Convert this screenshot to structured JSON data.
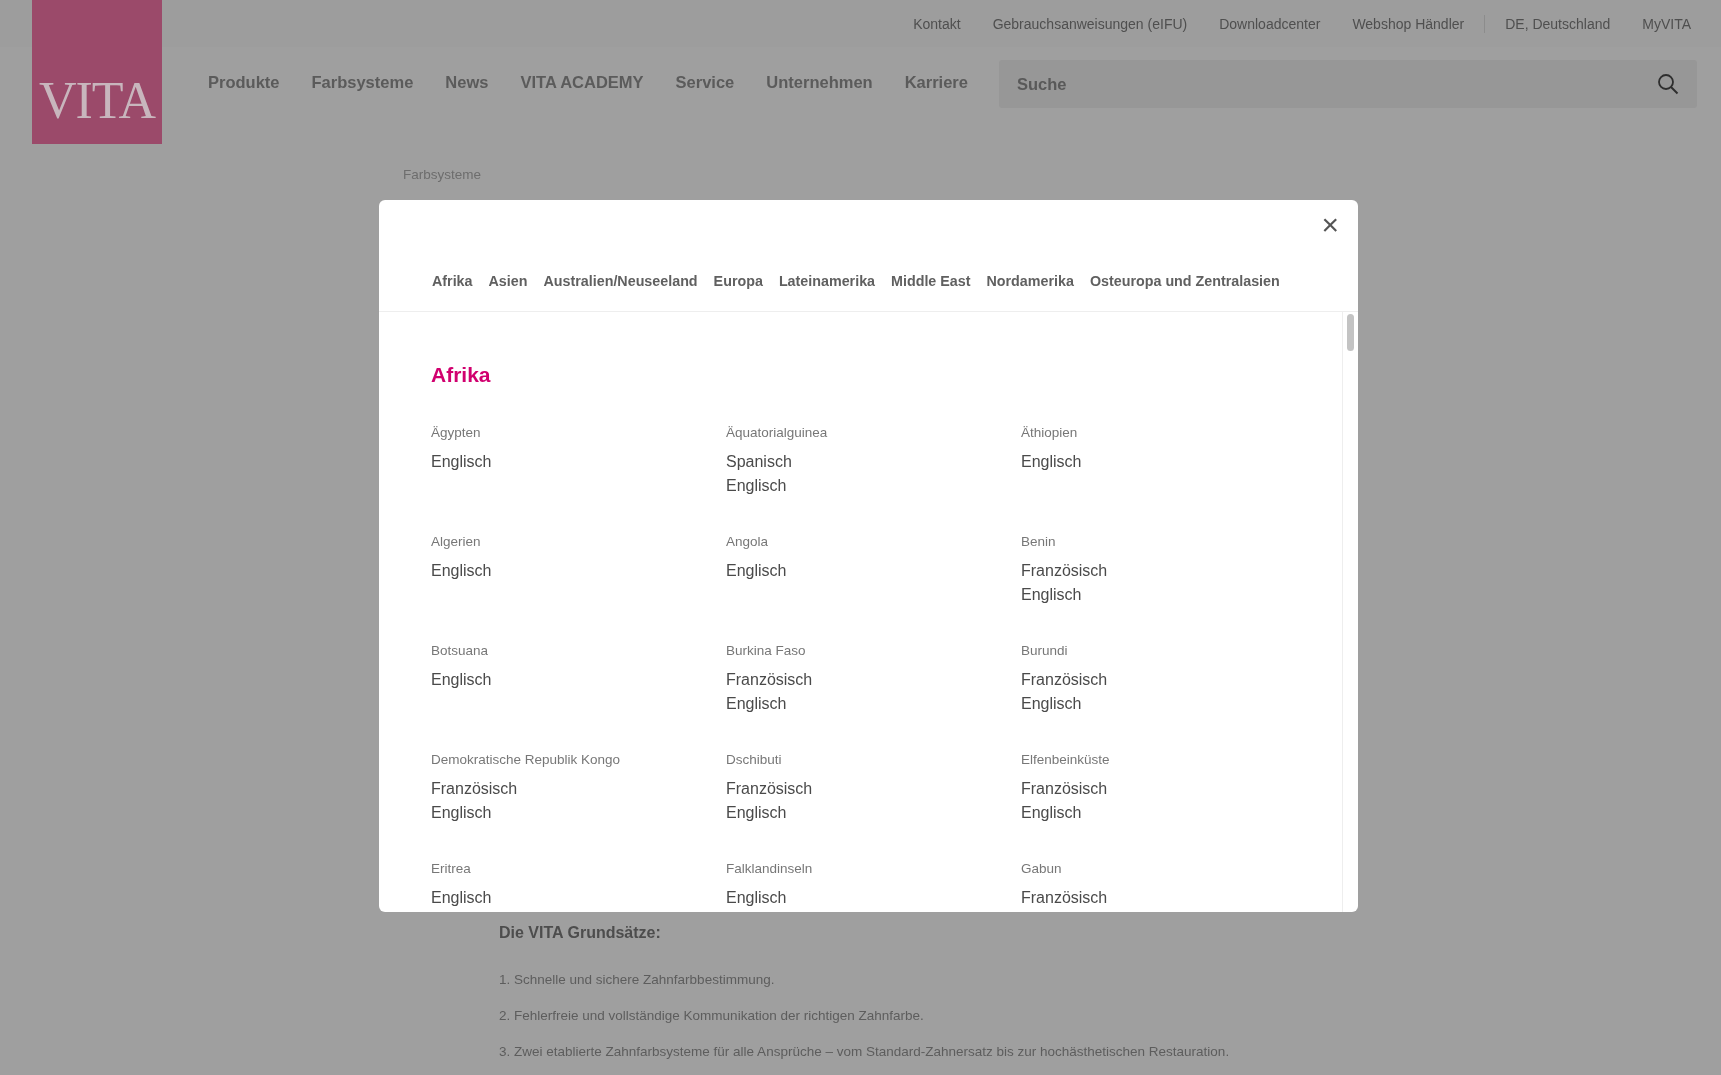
{
  "top_links": [
    "Kontakt",
    "Gebrauchsanweisungen (eIFU)",
    "Downloadcenter",
    "Webshop Händler",
    "DE, Deutschland",
    "MyVITA"
  ],
  "logo": {
    "text": "VITA"
  },
  "nav": [
    "Produkte",
    "Farbsysteme",
    "News",
    "VITA ACADEMY",
    "Service",
    "Unternehmen",
    "Karriere"
  ],
  "search": {
    "placeholder": "Suche"
  },
  "breadcrumb": "Farbsysteme",
  "page_heading": "Die VITA Grundsätze:",
  "page_list": [
    "1. Schnelle und sichere Zahnfarbbestimmung.",
    "2. Fehlerfreie und vollständige Kommunikation der richtigen Zahnfarbe.",
    "3. Zwei etablierte Zahnfarbsysteme für alle Ansprüche – vom Standard-Zahnersatz bis zur hochästhetischen Restauration."
  ],
  "modal": {
    "close": "×",
    "tabs": [
      {
        "label": "Afrika",
        "selected": false
      },
      {
        "label": "Asien",
        "selected": false
      },
      {
        "label": "Australien/Neuseeland",
        "selected": false
      },
      {
        "label": "Europa",
        "selected": false
      },
      {
        "label": "Lateinamerika",
        "selected": false
      },
      {
        "label": "Middle East",
        "selected": false
      },
      {
        "label": "Nordamerika",
        "selected": false
      },
      {
        "label": "Osteuropa und Zentralasien",
        "selected": false
      }
    ],
    "section_title": "Afrika",
    "countries": [
      {
        "name": "Ägypten",
        "languages": [
          "Englisch"
        ]
      },
      {
        "name": "Äquatorialguinea",
        "languages": [
          "Spanisch",
          "Englisch"
        ]
      },
      {
        "name": "Äthiopien",
        "languages": [
          "Englisch"
        ]
      },
      {
        "name": "Algerien",
        "languages": [
          "Englisch"
        ]
      },
      {
        "name": "Angola",
        "languages": [
          "Englisch"
        ]
      },
      {
        "name": "Benin",
        "languages": [
          "Französisch",
          "Englisch"
        ]
      },
      {
        "name": "Botsuana",
        "languages": [
          "Englisch"
        ]
      },
      {
        "name": "Burkina Faso",
        "languages": [
          "Französisch",
          "Englisch"
        ]
      },
      {
        "name": "Burundi",
        "languages": [
          "Französisch",
          "Englisch"
        ]
      },
      {
        "name": "Demokratische Republik Kongo",
        "languages": [
          "Französisch",
          "Englisch"
        ]
      },
      {
        "name": "Dschibuti",
        "languages": [
          "Französisch",
          "Englisch"
        ]
      },
      {
        "name": "Elfenbeinküste",
        "languages": [
          "Französisch",
          "Englisch"
        ]
      },
      {
        "name": "Eritrea",
        "languages": [
          "Englisch"
        ]
      },
      {
        "name": "Falklandinseln",
        "languages": [
          "Englisch"
        ]
      },
      {
        "name": "Gabun",
        "languages": [
          "Französisch"
        ]
      }
    ]
  }
}
